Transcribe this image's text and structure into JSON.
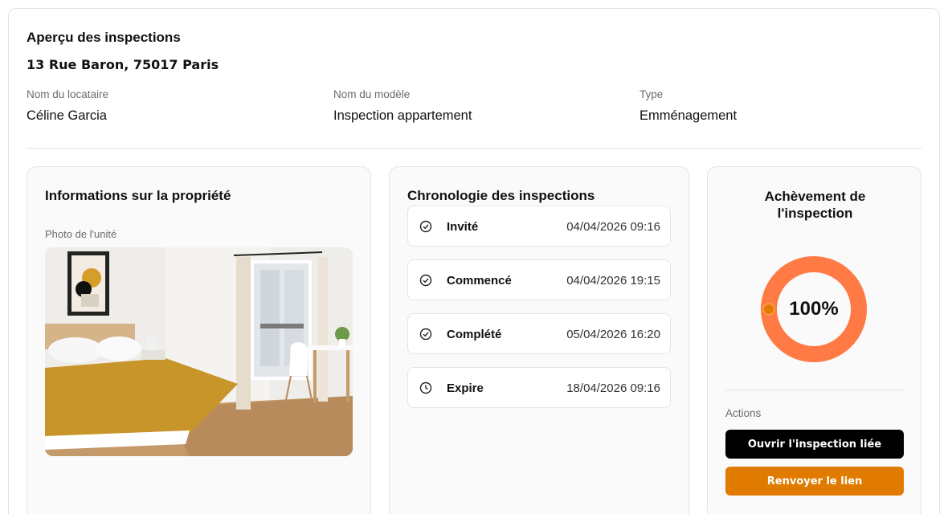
{
  "header": {
    "title": "Aperçu des inspections",
    "address": "13 Rue Baron, 75017 Paris"
  },
  "meta": [
    {
      "label": "Nom du locataire",
      "value": "Céline Garcia"
    },
    {
      "label": "Nom du modèle",
      "value": "Inspection appartement"
    },
    {
      "label": "Type",
      "value": "Emménagement"
    }
  ],
  "property": {
    "title": "Informations sur la propriété",
    "photo_label": "Photo de l'unité"
  },
  "timeline": {
    "title": "Chronologie des inspections",
    "items": [
      {
        "name": "Invité",
        "date": "04/04/2026 09:16",
        "icon": "check-circle-icon"
      },
      {
        "name": "Commencé",
        "date": "04/04/2026 19:15",
        "icon": "check-circle-icon"
      },
      {
        "name": "Complété",
        "date": "05/04/2026 16:20",
        "icon": "check-circle-icon"
      },
      {
        "name": "Expire",
        "date": "18/04/2026 09:16",
        "icon": "clock-icon"
      }
    ]
  },
  "completion": {
    "title": "Achèvement de l'inspection",
    "percent_label": "100%",
    "percent": 100,
    "ring_color": "#ff7a45",
    "actions_label": "Actions",
    "open_button": "Ouvrir l'inspection liée",
    "resend_button": "Renvoyer le lien"
  }
}
